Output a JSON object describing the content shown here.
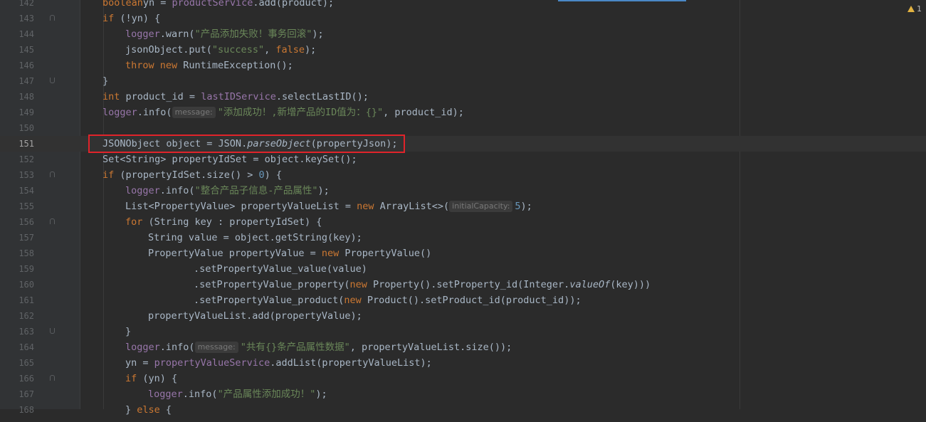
{
  "editor": {
    "lines": [
      {
        "no": "142",
        "fold": "",
        "indent": 1,
        "parts": [
          [
            "kw",
            "boolean"
          ],
          [
            "",
            "yn = "
          ],
          [
            "fld",
            "productService"
          ],
          [
            "",
            ".add(product);"
          ]
        ]
      },
      {
        "no": "143",
        "fold": "down",
        "indent": 1,
        "parts": [
          [
            "kw",
            "if"
          ],
          [
            "",
            " (!yn) {"
          ]
        ]
      },
      {
        "no": "144",
        "fold": "",
        "indent": 2,
        "parts": [
          [
            "fld",
            "logger"
          ],
          [
            "",
            ".warn("
          ],
          [
            "str",
            "\"产品添加失败！事务回滚\""
          ],
          [
            "",
            ");"
          ]
        ]
      },
      {
        "no": "145",
        "fold": "",
        "indent": 2,
        "parts": [
          [
            "",
            "jsonObject.put("
          ],
          [
            "str",
            "\"success\""
          ],
          [
            "",
            ", "
          ],
          [
            "kw",
            "false"
          ],
          [
            "",
            ");"
          ]
        ]
      },
      {
        "no": "146",
        "fold": "",
        "indent": 2,
        "parts": [
          [
            "kw",
            "throw new"
          ],
          [
            "",
            " RuntimeException();"
          ]
        ]
      },
      {
        "no": "147",
        "fold": "up",
        "indent": 1,
        "parts": [
          [
            "",
            "}"
          ]
        ]
      },
      {
        "no": "148",
        "fold": "",
        "indent": 1,
        "parts": [
          [
            "kw",
            "int"
          ],
          [
            "",
            " product_id = "
          ],
          [
            "fld",
            "lastIDService"
          ],
          [
            "",
            ".selectLastID();"
          ]
        ]
      },
      {
        "no": "149",
        "fold": "",
        "indent": 1,
        "parts": [
          [
            "fld",
            "logger"
          ],
          [
            "",
            ".info("
          ],
          [
            "hint",
            "message:"
          ],
          [
            "str",
            "\"添加成功！,新增产品的ID值为：{}\""
          ],
          [
            "",
            ", product_id);"
          ]
        ]
      },
      {
        "no": "150",
        "fold": "",
        "indent": 1,
        "parts": []
      },
      {
        "no": "151",
        "fold": "",
        "indent": 1,
        "current": true,
        "parts": [
          [
            "",
            "JSONObject object = JSON."
          ],
          [
            "ital",
            "parseObject"
          ],
          [
            "",
            "(propertyJson);"
          ]
        ]
      },
      {
        "no": "152",
        "fold": "",
        "indent": 1,
        "parts": [
          [
            "",
            "Set<String> propertyIdSet = object.keySet();"
          ]
        ]
      },
      {
        "no": "153",
        "fold": "down",
        "indent": 1,
        "parts": [
          [
            "kw",
            "if"
          ],
          [
            "",
            " (propertyIdSet.size() > "
          ],
          [
            "num",
            "0"
          ],
          [
            "",
            ") {"
          ]
        ]
      },
      {
        "no": "154",
        "fold": "",
        "indent": 2,
        "parts": [
          [
            "fld",
            "logger"
          ],
          [
            "",
            ".info("
          ],
          [
            "str",
            "\"整合产品子信息-产品属性\""
          ],
          [
            "",
            ");"
          ]
        ]
      },
      {
        "no": "155",
        "fold": "",
        "indent": 2,
        "parts": [
          [
            "",
            "List<PropertyValue> propertyValueList = "
          ],
          [
            "kw",
            "new"
          ],
          [
            "",
            " ArrayList<>("
          ],
          [
            "hint",
            "initialCapacity:"
          ],
          [
            "num",
            "5"
          ],
          [
            "",
            ");"
          ]
        ]
      },
      {
        "no": "156",
        "fold": "down",
        "indent": 2,
        "parts": [
          [
            "kw",
            "for"
          ],
          [
            "",
            " (String key : propertyIdSet) {"
          ]
        ]
      },
      {
        "no": "157",
        "fold": "",
        "indent": 3,
        "parts": [
          [
            "",
            "String value = object.getString(key);"
          ]
        ]
      },
      {
        "no": "158",
        "fold": "",
        "indent": 3,
        "parts": [
          [
            "",
            "PropertyValue propertyValue = "
          ],
          [
            "kw",
            "new"
          ],
          [
            "",
            " PropertyValue()"
          ]
        ]
      },
      {
        "no": "159",
        "fold": "",
        "indent": 5,
        "parts": [
          [
            "",
            ".setPropertyValue_value(value)"
          ]
        ]
      },
      {
        "no": "160",
        "fold": "",
        "indent": 5,
        "parts": [
          [
            "",
            ".setPropertyValue_property("
          ],
          [
            "kw",
            "new"
          ],
          [
            "",
            " Property().setProperty_id(Integer."
          ],
          [
            "ital",
            "valueOf"
          ],
          [
            "",
            "(key)))"
          ]
        ]
      },
      {
        "no": "161",
        "fold": "",
        "indent": 5,
        "parts": [
          [
            "",
            ".setPropertyValue_product("
          ],
          [
            "kw",
            "new"
          ],
          [
            "",
            " Product().setProduct_id(product_id));"
          ]
        ]
      },
      {
        "no": "162",
        "fold": "",
        "indent": 3,
        "parts": [
          [
            "",
            "propertyValueList.add(propertyValue);"
          ]
        ]
      },
      {
        "no": "163",
        "fold": "up",
        "indent": 2,
        "parts": [
          [
            "",
            "}"
          ]
        ]
      },
      {
        "no": "164",
        "fold": "",
        "indent": 2,
        "parts": [
          [
            "fld",
            "logger"
          ],
          [
            "",
            ".info("
          ],
          [
            "hint",
            "message:"
          ],
          [
            "str",
            "\"共有{}条产品属性数据\""
          ],
          [
            "",
            ", propertyValueList.size());"
          ]
        ]
      },
      {
        "no": "165",
        "fold": "",
        "indent": 2,
        "parts": [
          [
            "",
            "yn = "
          ],
          [
            "fld",
            "propertyValueService"
          ],
          [
            "",
            ".addList(propertyValueList);"
          ]
        ]
      },
      {
        "no": "166",
        "fold": "down",
        "indent": 2,
        "parts": [
          [
            "kw",
            "if"
          ],
          [
            "",
            " (yn) {"
          ]
        ]
      },
      {
        "no": "167",
        "fold": "",
        "indent": 3,
        "parts": [
          [
            "fld",
            "logger"
          ],
          [
            "",
            ".info("
          ],
          [
            "str",
            "\"产品属性添加成功！\""
          ],
          [
            "",
            ");"
          ]
        ]
      },
      {
        "no": "168",
        "fold": "",
        "indent": 2,
        "parts": [
          [
            "",
            "} "
          ],
          [
            "kw",
            "else"
          ],
          [
            "",
            " {"
          ]
        ]
      }
    ]
  },
  "inspection": {
    "count": "1",
    "icon": "warning-icon"
  },
  "colors": {
    "keyword": "#cc7832",
    "string": "#6a8759",
    "field": "#9876aa",
    "number": "#6897bb",
    "highlight": "#e0232a"
  }
}
